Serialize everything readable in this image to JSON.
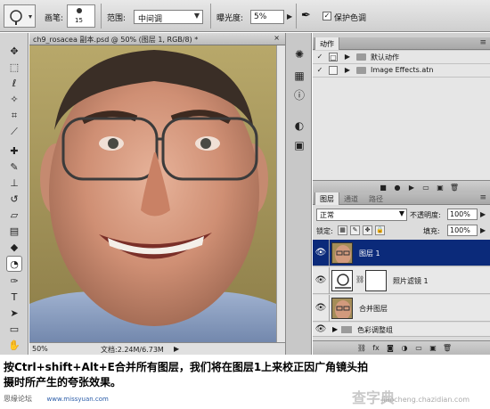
{
  "options_bar": {
    "brush_label": "画笔:",
    "brush_size": "15",
    "range_label": "范围:",
    "range_value": "中间调",
    "exposure_label": "曝光度:",
    "exposure_value": "5%",
    "protect_tone_label": "保护色调",
    "protect_tone_checked": "✓"
  },
  "document": {
    "tab_title": "ch9_rosacea 副本.psd @ 50% (图层 1, RGB/8) *",
    "zoom": "50%",
    "doc_size": "文档:2.24M/6.73M"
  },
  "actions_panel": {
    "tab_label": "动作",
    "items": [
      {
        "check": "✓",
        "label": "默认动作"
      },
      {
        "check": "✓",
        "label": "Image Effects.atn"
      }
    ]
  },
  "layers_panel": {
    "tabs": [
      "图层",
      "通道",
      "路径"
    ],
    "blend_mode": "正常",
    "opacity_label": "不透明度:",
    "opacity_value": "100%",
    "lock_label": "锁定:",
    "fill_label": "填充:",
    "fill_value": "100%",
    "layers": [
      {
        "name": "图层 1",
        "selected": true
      },
      {
        "name": "照片滤镜 1",
        "selected": false
      },
      {
        "name": "合并图层",
        "selected": false
      }
    ],
    "group": {
      "name": "色彩调整组"
    }
  },
  "caption": {
    "text": "按Ctrl+shift+Alt+E合并所有图层，我们将在图层1上来校正因广角镜头拍摄时所产生的夸张效果。",
    "watermark_left": "思缘论坛",
    "watermark_site": "www.missyuan.com",
    "watermark_right": "查字典",
    "watermark_url": "jiaocheng.chazidian.com"
  },
  "colors": {
    "selected_layer": "#0b2a7a",
    "panel_bg": "#d0d0d0"
  }
}
